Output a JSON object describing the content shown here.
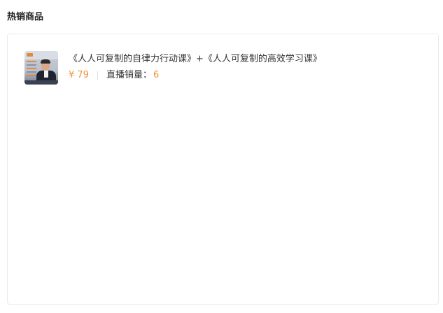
{
  "section": {
    "title": "热销商品"
  },
  "products": [
    {
      "thumbnail_icon": "course-cover-image",
      "title": "《人人可复制的自律力行动课》+《人人可复制的高效学习课》",
      "price": "¥ 79",
      "sales_label": "直播销量：",
      "sales_value": "6"
    }
  ],
  "colors": {
    "accent": "#f0923a",
    "text": "#333333",
    "border": "#ebebeb"
  }
}
